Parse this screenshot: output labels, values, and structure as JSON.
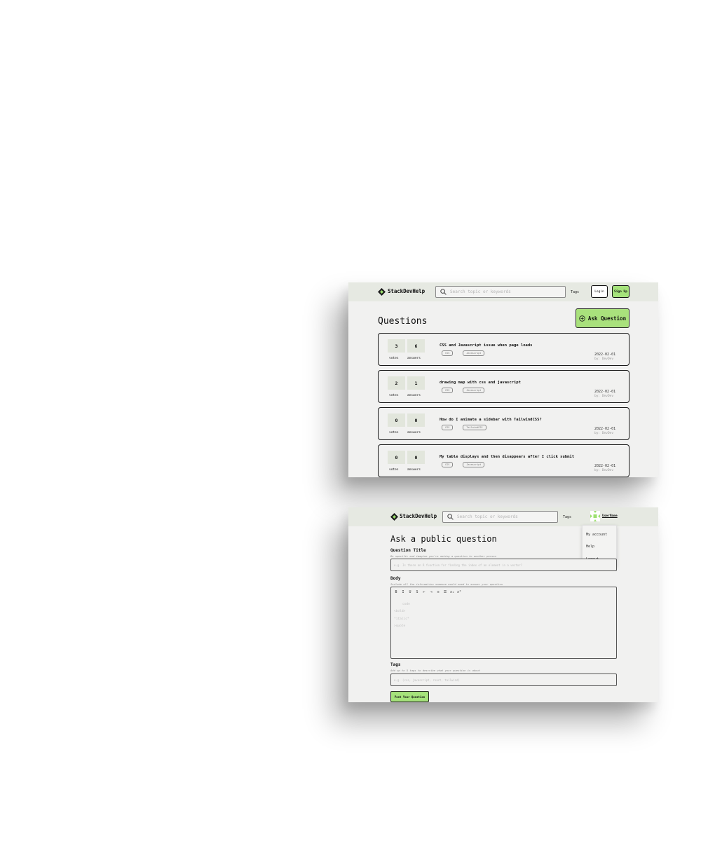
{
  "brand": "StackDevHelp",
  "search": {
    "placeholder": "Search topic or keywords"
  },
  "nav": {
    "tags": "Tags",
    "login": "Login",
    "signup": "Sign Up",
    "username": "UserName"
  },
  "questions_page": {
    "title": "Questions",
    "ask_button": "Ask Question",
    "stat_labels": {
      "votes": "votes",
      "answers": "answers"
    },
    "questions": [
      {
        "votes": "3",
        "answers": "6",
        "title": "CSS and Javascript issue when page loads",
        "tags": [
          "CSS",
          "Javascript"
        ],
        "date": "2022-02-01",
        "author": "by: DevDev"
      },
      {
        "votes": "2",
        "answers": "1",
        "title": "drawing map with css and javascript",
        "tags": [
          "CSS",
          "Javascript"
        ],
        "date": "2022-02-01",
        "author": "by: DevDev"
      },
      {
        "votes": "0",
        "answers": "0",
        "title": "How do I animate a sidebar with TailwindCSS?",
        "tags": [
          "CSS",
          "TailwindCSS"
        ],
        "date": "2022-02-01",
        "author": "by: DevDev"
      },
      {
        "votes": "0",
        "answers": "0",
        "title": "My table displays and then disappears after I click submit",
        "tags": [
          "CSS",
          "Javascript"
        ],
        "date": "2022-02-01",
        "author": "by: DevDev"
      }
    ]
  },
  "ask_page": {
    "title": "Ask a public question",
    "dropdown": [
      "My account",
      "Help",
      "Logout"
    ],
    "question_title": {
      "label": "Question Title",
      "hint": "Be specific and imagine you're asking a question to another person",
      "placeholder": "e.g. Is there an R function for finding the index of an element in a vector?"
    },
    "body": {
      "label": "Body",
      "hint": "Include all the information someone would need to answer your question",
      "toolbar": [
        "B",
        "I",
        "U",
        "S",
        "⇤",
        "⇥",
        "≡",
        "☰",
        "x₂",
        "x²"
      ],
      "lines": [
        "code",
        "<bold>",
        "*italic*",
        ">quote"
      ]
    },
    "tags": {
      "label": "Tags",
      "hint": "Add up to 5 tags to describe what your question is about",
      "placeholder": "e.g. (css, javascript, react, tailwind)"
    },
    "post_button": "Post Your Question"
  },
  "colors": {
    "accent": "#a9e17c",
    "nav_bg": "#e6e9e2",
    "page_bg": "#f1f1f0",
    "stat_bg": "#e2e6dc"
  }
}
